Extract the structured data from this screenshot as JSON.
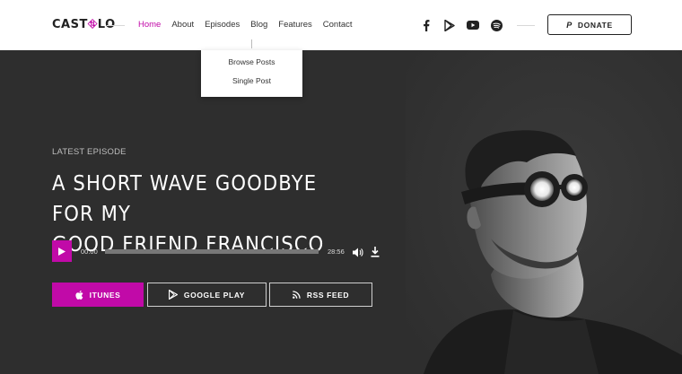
{
  "header": {
    "logo": {
      "prefix": "CAST",
      "suffix": "LO"
    },
    "nav": [
      {
        "label": "Home",
        "active": true
      },
      {
        "label": "About",
        "active": false
      },
      {
        "label": "Episodes",
        "active": false
      },
      {
        "label": "Blog",
        "active": false
      },
      {
        "label": "Features",
        "active": false
      },
      {
        "label": "Contact",
        "active": false
      }
    ],
    "socials": [
      "facebook-icon",
      "google-play-icon",
      "youtube-icon",
      "spotify-icon"
    ],
    "donate_label": "DONATE"
  },
  "dropdown": {
    "items": [
      "Browse Posts",
      "Single Post"
    ]
  },
  "hero": {
    "eyebrow": "LATEST EPISODE",
    "title_line1": "A SHORT WAVE GOODBYE FOR MY",
    "title_line2": "GOOD FRIEND FRANCISCO",
    "player": {
      "current_time": "00:00",
      "duration": "28:56",
      "progress": 0
    },
    "buttons": {
      "itunes": "ITUNES",
      "google_play": "GOOGLE PLAY",
      "rss": "RSS FEED"
    }
  },
  "colors": {
    "accent": "#c10aa8",
    "hero_bg": "#2e2e2e",
    "header_bg": "#ffffff"
  }
}
